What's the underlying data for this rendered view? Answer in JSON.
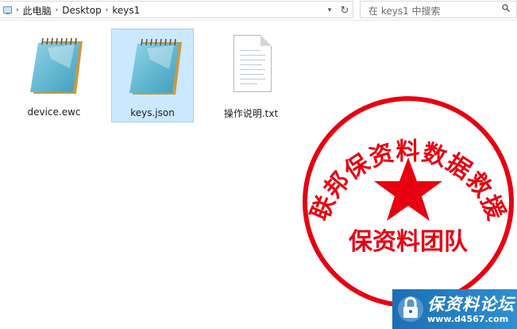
{
  "address_bar": {
    "breadcrumbs": [
      "此电脑",
      "Desktop",
      "keys1"
    ],
    "search_placeholder": "在 keys1 中搜索"
  },
  "files": [
    {
      "name": "device.ewc",
      "icon": "notepad-icon",
      "selected": false
    },
    {
      "name": "keys.json",
      "icon": "notepad-icon",
      "selected": true
    },
    {
      "name": "操作说明.txt",
      "icon": "text-file-icon",
      "selected": false
    }
  ],
  "stamp": {
    "arc_text": "联邦保资料数据救援",
    "center_text": "保资料团队",
    "color": "#e60012"
  },
  "watermark": {
    "title": "保资料论坛",
    "url": "www.d4567.com",
    "color": "#1a6fb5"
  }
}
